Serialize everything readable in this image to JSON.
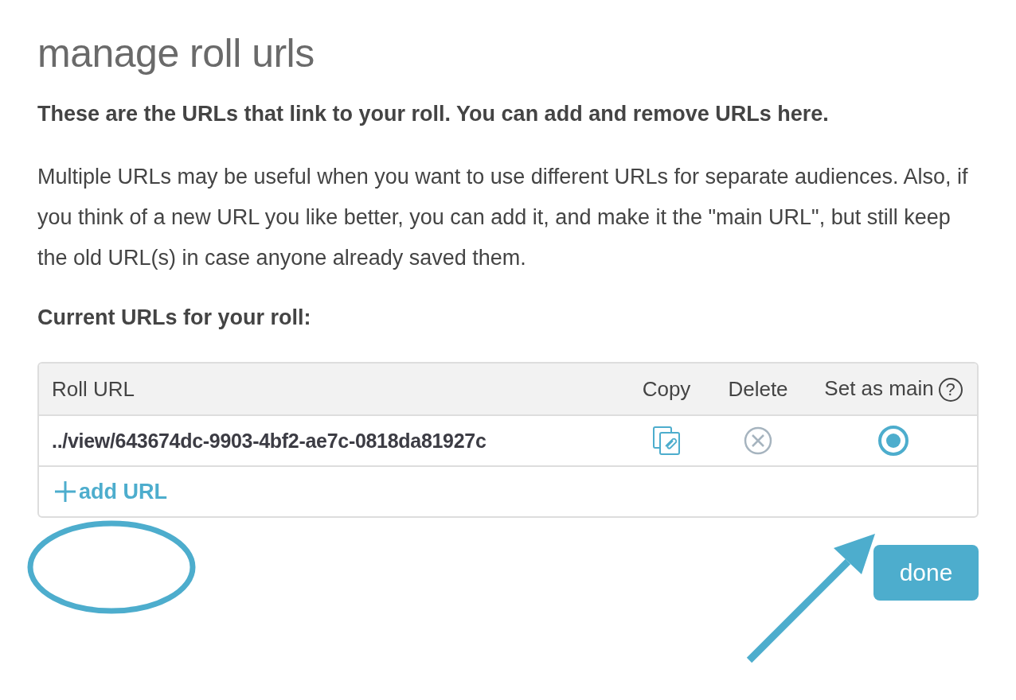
{
  "dialog": {
    "title": "manage roll urls",
    "intro": "These are the URLs that link to your roll. You can add and remove URLs here.",
    "description": "Multiple URLs may be useful when you want to use different URLs for separate audiences. Also, if you think of a new URL you like better, you can add it, and make it the \"main URL\", but still keep the old URL(s) in case anyone already saved them.",
    "section_heading": "Current URLs for your roll:"
  },
  "table": {
    "columns": [
      "Roll URL",
      "Copy",
      "Delete",
      "Set as main"
    ],
    "help_mark": "?",
    "rows": [
      {
        "url": "../view/643674dc-9903-4bf2-ae7c-0818da81927c",
        "selected": true
      }
    ],
    "add_label": "add URL"
  },
  "buttons": [
    {
      "label": "done"
    }
  ]
}
